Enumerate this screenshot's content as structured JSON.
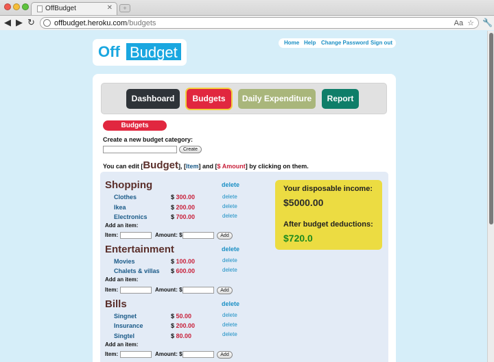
{
  "browser": {
    "tab_title": "OffBudget",
    "tab_close": "✕",
    "new_tab": "+",
    "url_host": "offbudget.heroku.com",
    "url_path": "/budgets",
    "url_icons": [
      "Aa",
      "☆"
    ],
    "nav_back": "◀",
    "nav_forward": "▶",
    "nav_reload": "↻",
    "menu_icon": "🔧"
  },
  "logo": {
    "off": "Off",
    "budget": "Budget"
  },
  "toplinks": {
    "home": "Home",
    "help": "Help",
    "change_password": "Change Password",
    "sign_out": "Sign out"
  },
  "nav": {
    "dashboard": "Dashboard",
    "budgets": "Budgets",
    "daily": "Daily Expenditure",
    "report": "Report"
  },
  "section_title": "Budgets",
  "create": {
    "label": "Create a new budget category:",
    "value": "",
    "button": "Create"
  },
  "help": {
    "prefix": "You can edit [",
    "budget": "Budget",
    "mid1": "], [",
    "item": "Item",
    "mid2": "] and [",
    "amount": "$ Amount",
    "suffix": "] by clicking on them."
  },
  "categories": [
    {
      "title": "Shopping",
      "delete": "delete",
      "items": [
        {
          "name": "Clothes",
          "currency": "$",
          "amount": "300.00",
          "delete": "delete"
        },
        {
          "name": "Ikea",
          "currency": "$",
          "amount": "200.00",
          "delete": "delete"
        },
        {
          "name": "Electronics",
          "currency": "$",
          "amount": "700.00",
          "delete": "delete"
        }
      ],
      "add_label": "Add an item:",
      "item_label": "Item:",
      "amount_label": "Amount:",
      "amount_prefix": "$",
      "add_button": "Add"
    },
    {
      "title": "Entertainment",
      "delete": "delete",
      "items": [
        {
          "name": "Movies",
          "currency": "$",
          "amount": "100.00",
          "delete": "delete"
        },
        {
          "name": "Chalets & villas",
          "currency": "$",
          "amount": "600.00",
          "delete": "delete"
        }
      ],
      "add_label": "Add an item:",
      "item_label": "Item:",
      "amount_label": "Amount:",
      "amount_prefix": "$",
      "add_button": "Add"
    },
    {
      "title": "Bills",
      "delete": "delete",
      "items": [
        {
          "name": "Singnet",
          "currency": "$",
          "amount": "50.00",
          "delete": "delete"
        },
        {
          "name": "Insurance",
          "currency": "$",
          "amount": "200.00",
          "delete": "delete"
        },
        {
          "name": "Singtel",
          "currency": "$",
          "amount": "80.00",
          "delete": "delete"
        }
      ],
      "add_label": "Add an item:",
      "item_label": "Item:",
      "amount_label": "Amount:",
      "amount_prefix": "$",
      "add_button": "Add"
    }
  ],
  "income": {
    "disposable_label": "Your disposable income:",
    "disposable_value": "$5000.00",
    "after_label": "After budget deductions:",
    "after_value": "$720.0"
  },
  "colors": {
    "accent_blue": "#1aa7e0",
    "budgets_red": "#e1273f",
    "income_yellow": "#ecdc42",
    "positive_green": "#1e8a1e"
  }
}
